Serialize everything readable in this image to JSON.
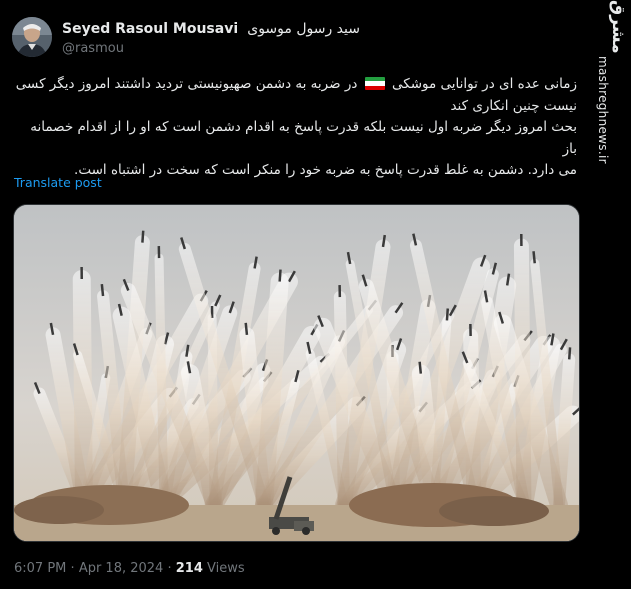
{
  "author": {
    "display_name": "Seyed Rasoul Mousavi",
    "display_name_fa": "سید رسول موسوی",
    "handle": "@rasmou"
  },
  "post": {
    "line1_part1": "زمانی عده ای در توانایی موشکی",
    "line1_part2": "در ضربه به دشمن صهیونیستی تردید داشتند امروز دیگر کسی",
    "line2": "نیست چنین انکاری کند",
    "line3": "بحث امروز دیگر ضربه اول نیست بلکه قدرت پاسخ به اقدام دشمن است که او را از  اقدام خصمانه باز",
    "line4": "می دارد. دشمن به غلط قدرت پاسخ به ضربه خود را منکر است که سخت در اشتباه است.",
    "translate_label": "Translate post",
    "media_icon": "missile-salvo-photo"
  },
  "meta": {
    "time": "6:07 PM",
    "separator": "·",
    "date": "Apr 18, 2024",
    "views_count": "214",
    "views_label": "Views"
  },
  "watermark": {
    "logo_text": "مشرق",
    "url": "mashreghnews.ir"
  },
  "colors": {
    "background": "#000000",
    "text": "#e7e9ea",
    "muted": "#71767b",
    "link": "#1d9bf0",
    "flag_green": "#239f40",
    "flag_white": "#ffffff",
    "flag_red": "#da0000"
  }
}
